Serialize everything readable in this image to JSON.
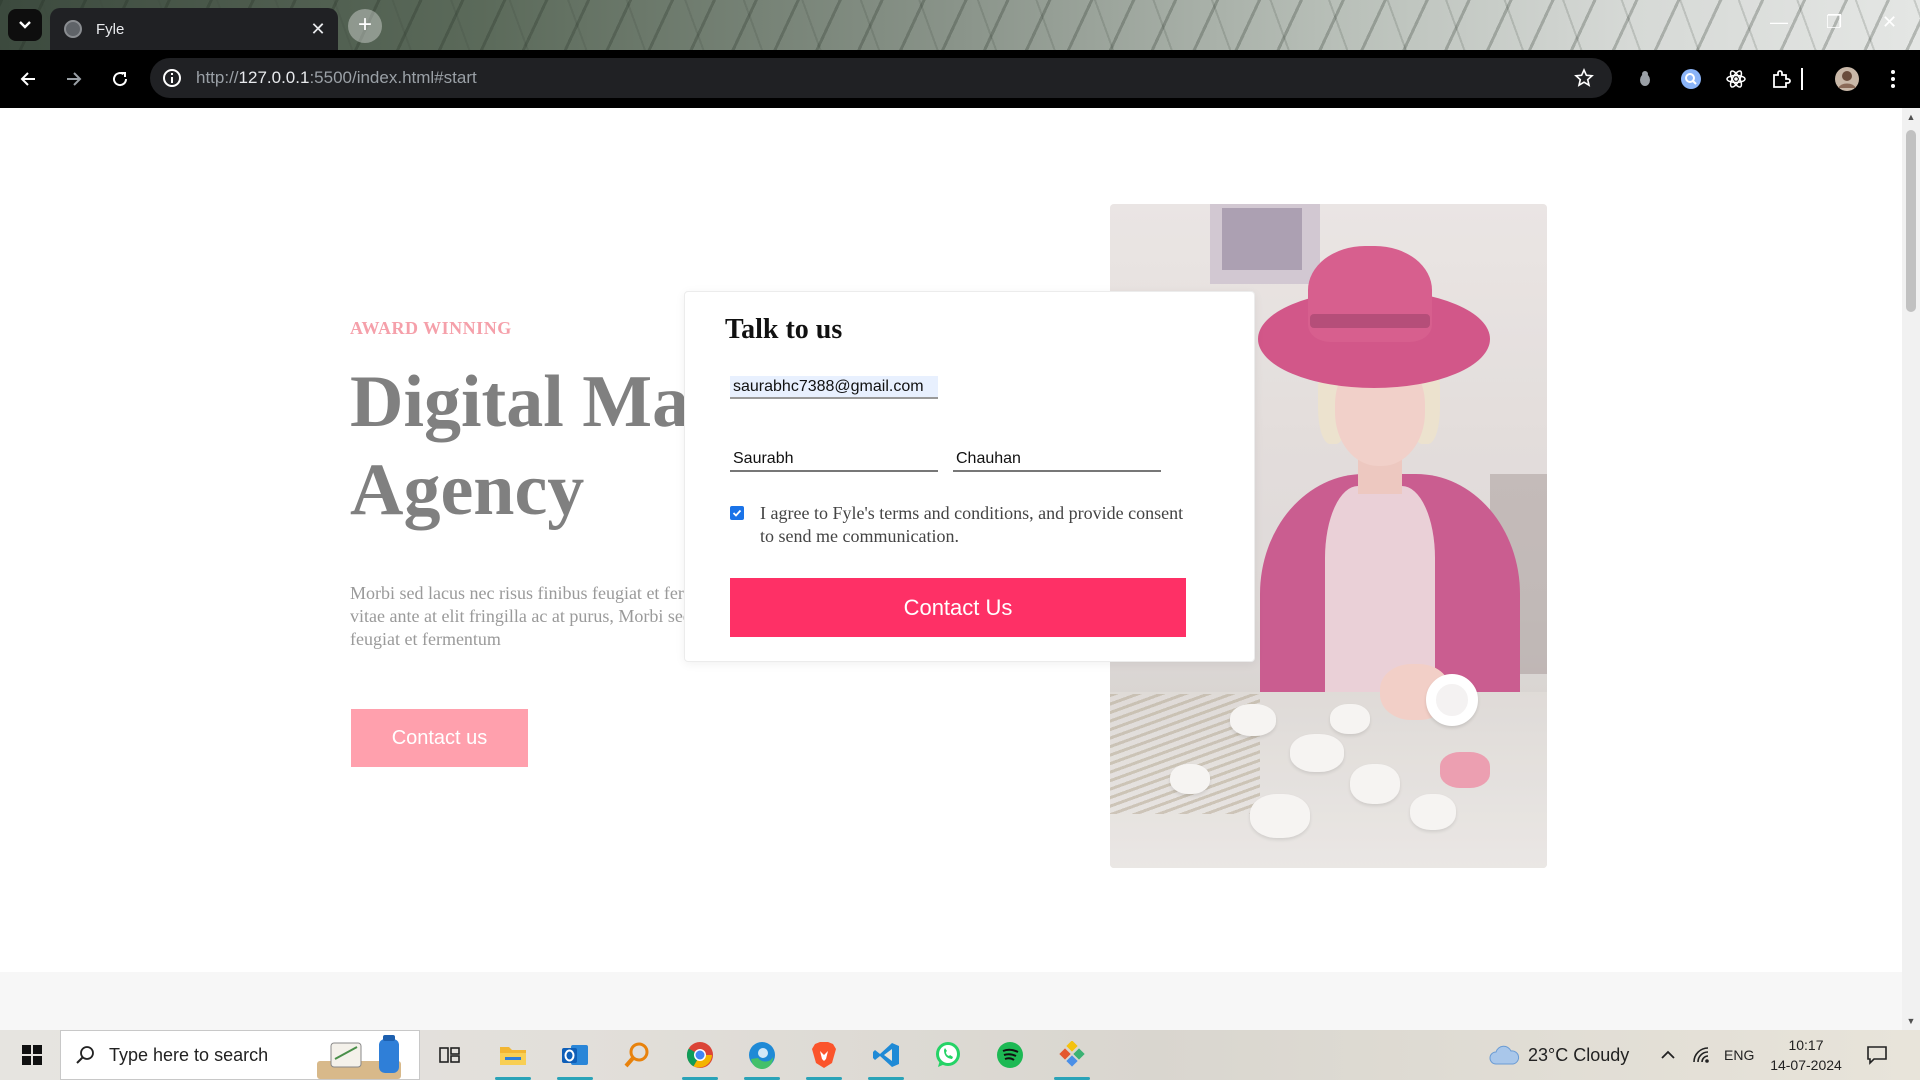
{
  "browser": {
    "tab_title": "Fyle",
    "tab_close": "✕",
    "new_tab": "+",
    "url_prefix": "http://",
    "url_host": "127.0.0.1",
    "url_rest": ":5500/index.html#start"
  },
  "hero": {
    "eyebrow": "AWARD WINNING",
    "title_line1": "Digital Marketing",
    "title_line2": "Agency",
    "text": "Morbi sed lacus nec risus finibus feugiat et fermentum nibh. Pellentesque vitae ante at elit fringilla ac at purus, Morbi sed lacus nec risus finibus feugiat et fermentum",
    "button": "Contact us"
  },
  "modal": {
    "title": "Talk to us",
    "email_value": "saurabhc7388@gmail.com",
    "first_name_value": "Saurabh",
    "last_name_value": "Chauhan",
    "consent_checked": true,
    "consent_text": "I agree to Fyle's terms and conditions, and provide consent to send me communication.",
    "submit_button": "Contact Us"
  },
  "taskbar": {
    "search_placeholder": "Type here to search",
    "weather": "23°C  Cloudy",
    "language": "ENG",
    "time": "10:17",
    "date": "14-07-2024",
    "apps": [
      "task-view",
      "file-explorer",
      "outlook",
      "search-tool",
      "chrome",
      "edge",
      "brave",
      "vscode",
      "whatsapp",
      "spotify",
      "git-tool"
    ]
  },
  "colors": {
    "accent_pink": "#fe3066",
    "soft_pink": "#ffa0ad",
    "eyebrow_pink": "#f5a0aa",
    "title_gray": "#808080"
  }
}
